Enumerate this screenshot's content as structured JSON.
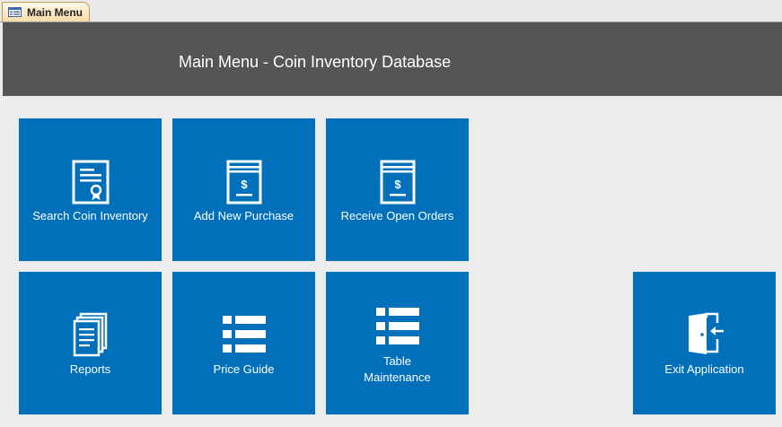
{
  "tab": {
    "label": "Main Menu",
    "icon": "form-icon"
  },
  "header": {
    "title": "Main Menu - Coin Inventory Database"
  },
  "tiles": {
    "search": {
      "label": "Search Coin Inventory",
      "icon": "certificate-icon"
    },
    "purchase": {
      "label": "Add New Purchase",
      "icon": "receipt-dollar-icon"
    },
    "receive": {
      "label": "Receive Open Orders",
      "icon": "receipt-dollar-icon"
    },
    "reports": {
      "label": "Reports",
      "icon": "documents-icon"
    },
    "price": {
      "label": "Price Guide",
      "icon": "list-icon"
    },
    "table_line1": "Table",
    "table_line2": "Maintenance",
    "table_icon": "list-icon",
    "exit": {
      "label": "Exit Application",
      "icon": "exit-door-icon"
    }
  },
  "colors": {
    "tile": "#0070bb",
    "header": "#555555",
    "background": "#ececec",
    "tab": "#f8dca8"
  }
}
